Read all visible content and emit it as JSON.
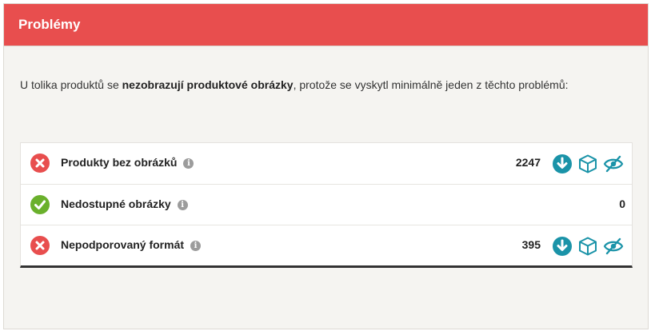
{
  "panel": {
    "title": "Problémy"
  },
  "intro": {
    "prefix": "U tolika produktů se ",
    "bold": "nezobrazují produktové obrázky",
    "suffix": ", protože se vyskytl minimálně jeden z těchto problémů:"
  },
  "rows": [
    {
      "label": "Produkty bez obrázků",
      "count": "2247",
      "status": "error",
      "status_icon": "x-circle-icon",
      "has_actions": true
    },
    {
      "label": "Nedostupné obrázky",
      "count": "0",
      "status": "ok",
      "status_icon": "check-circle-icon",
      "has_actions": false
    },
    {
      "label": "Nepodporovaný formát",
      "count": "395",
      "status": "error",
      "status_icon": "x-circle-icon",
      "has_actions": true
    }
  ],
  "info_glyph": "i",
  "colors": {
    "header": "#e84e4e",
    "error": "#e84e4e",
    "ok": "#6ab02c",
    "action": "#1a93a8"
  }
}
